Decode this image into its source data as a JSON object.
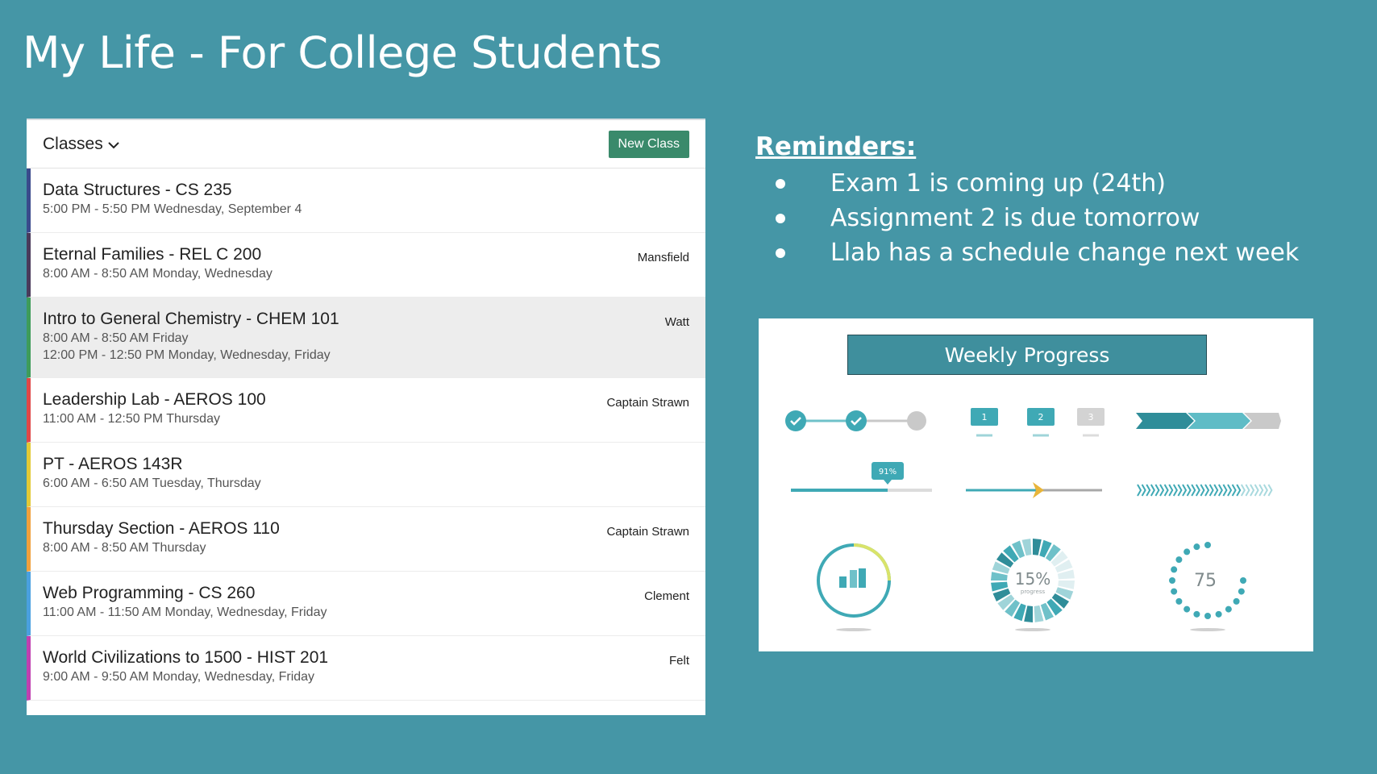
{
  "title": "My Life - For College Students",
  "classes_panel": {
    "header_label": "Classes",
    "new_class_label": "New Class",
    "rows": [
      {
        "name": "Data Structures - CS 235",
        "times": [
          "5:00 PM - 5:50 PM Wednesday, September 4"
        ],
        "instructor": "",
        "color": "#3a4a8c"
      },
      {
        "name": "Eternal Families - REL C 200",
        "times": [
          "8:00 AM - 8:50 AM Monday, Wednesday"
        ],
        "instructor": "Mansfield",
        "color": "#4a3a5a"
      },
      {
        "name": "Intro to General Chemistry - CHEM 101",
        "times": [
          "8:00 AM - 8:50 AM Friday",
          "12:00 PM - 12:50 PM Monday, Wednesday, Friday"
        ],
        "instructor": "Watt",
        "color": "#3e9c5a"
      },
      {
        "name": "Leadership Lab - AEROS 100",
        "times": [
          "11:00 AM - 12:50 PM Thursday"
        ],
        "instructor": "Captain Strawn",
        "color": "#e04848"
      },
      {
        "name": "PT - AEROS 143R",
        "times": [
          "6:00 AM - 6:50 AM Tuesday, Thursday"
        ],
        "instructor": "",
        "color": "#e2c936"
      },
      {
        "name": "Thursday Section - AEROS 110",
        "times": [
          "8:00 AM - 8:50 AM Thursday"
        ],
        "instructor": "Captain Strawn",
        "color": "#f0a03c"
      },
      {
        "name": "Web Programming - CS 260",
        "times": [
          "11:00 AM - 11:50 AM Monday, Wednesday, Friday"
        ],
        "instructor": "Clement",
        "color": "#4aa0e0"
      },
      {
        "name": "World Civilizations to 1500 - HIST 201",
        "times": [
          "9:00 AM - 9:50 AM Monday, Wednesday, Friday"
        ],
        "instructor": "Felt",
        "color": "#c040b0"
      }
    ]
  },
  "reminders": {
    "title": "Reminders:",
    "items": [
      "Exam 1 is coming up (24th)",
      "Assignment 2 is due tomorrow",
      "Llab has a schedule change next week"
    ]
  },
  "progress": {
    "title": "Weekly Progress",
    "slider_badge": "91%",
    "ring_center_value": "15%",
    "ring_center_sub": "progress",
    "dots_value": "75",
    "ring_percent": 0.15,
    "dots_percent": 0.75,
    "accent": "#3fa9b5"
  },
  "colors": {
    "background": "#4596a6",
    "button": "#3a8a6b",
    "card_title_bg": "#3f8f9d"
  }
}
